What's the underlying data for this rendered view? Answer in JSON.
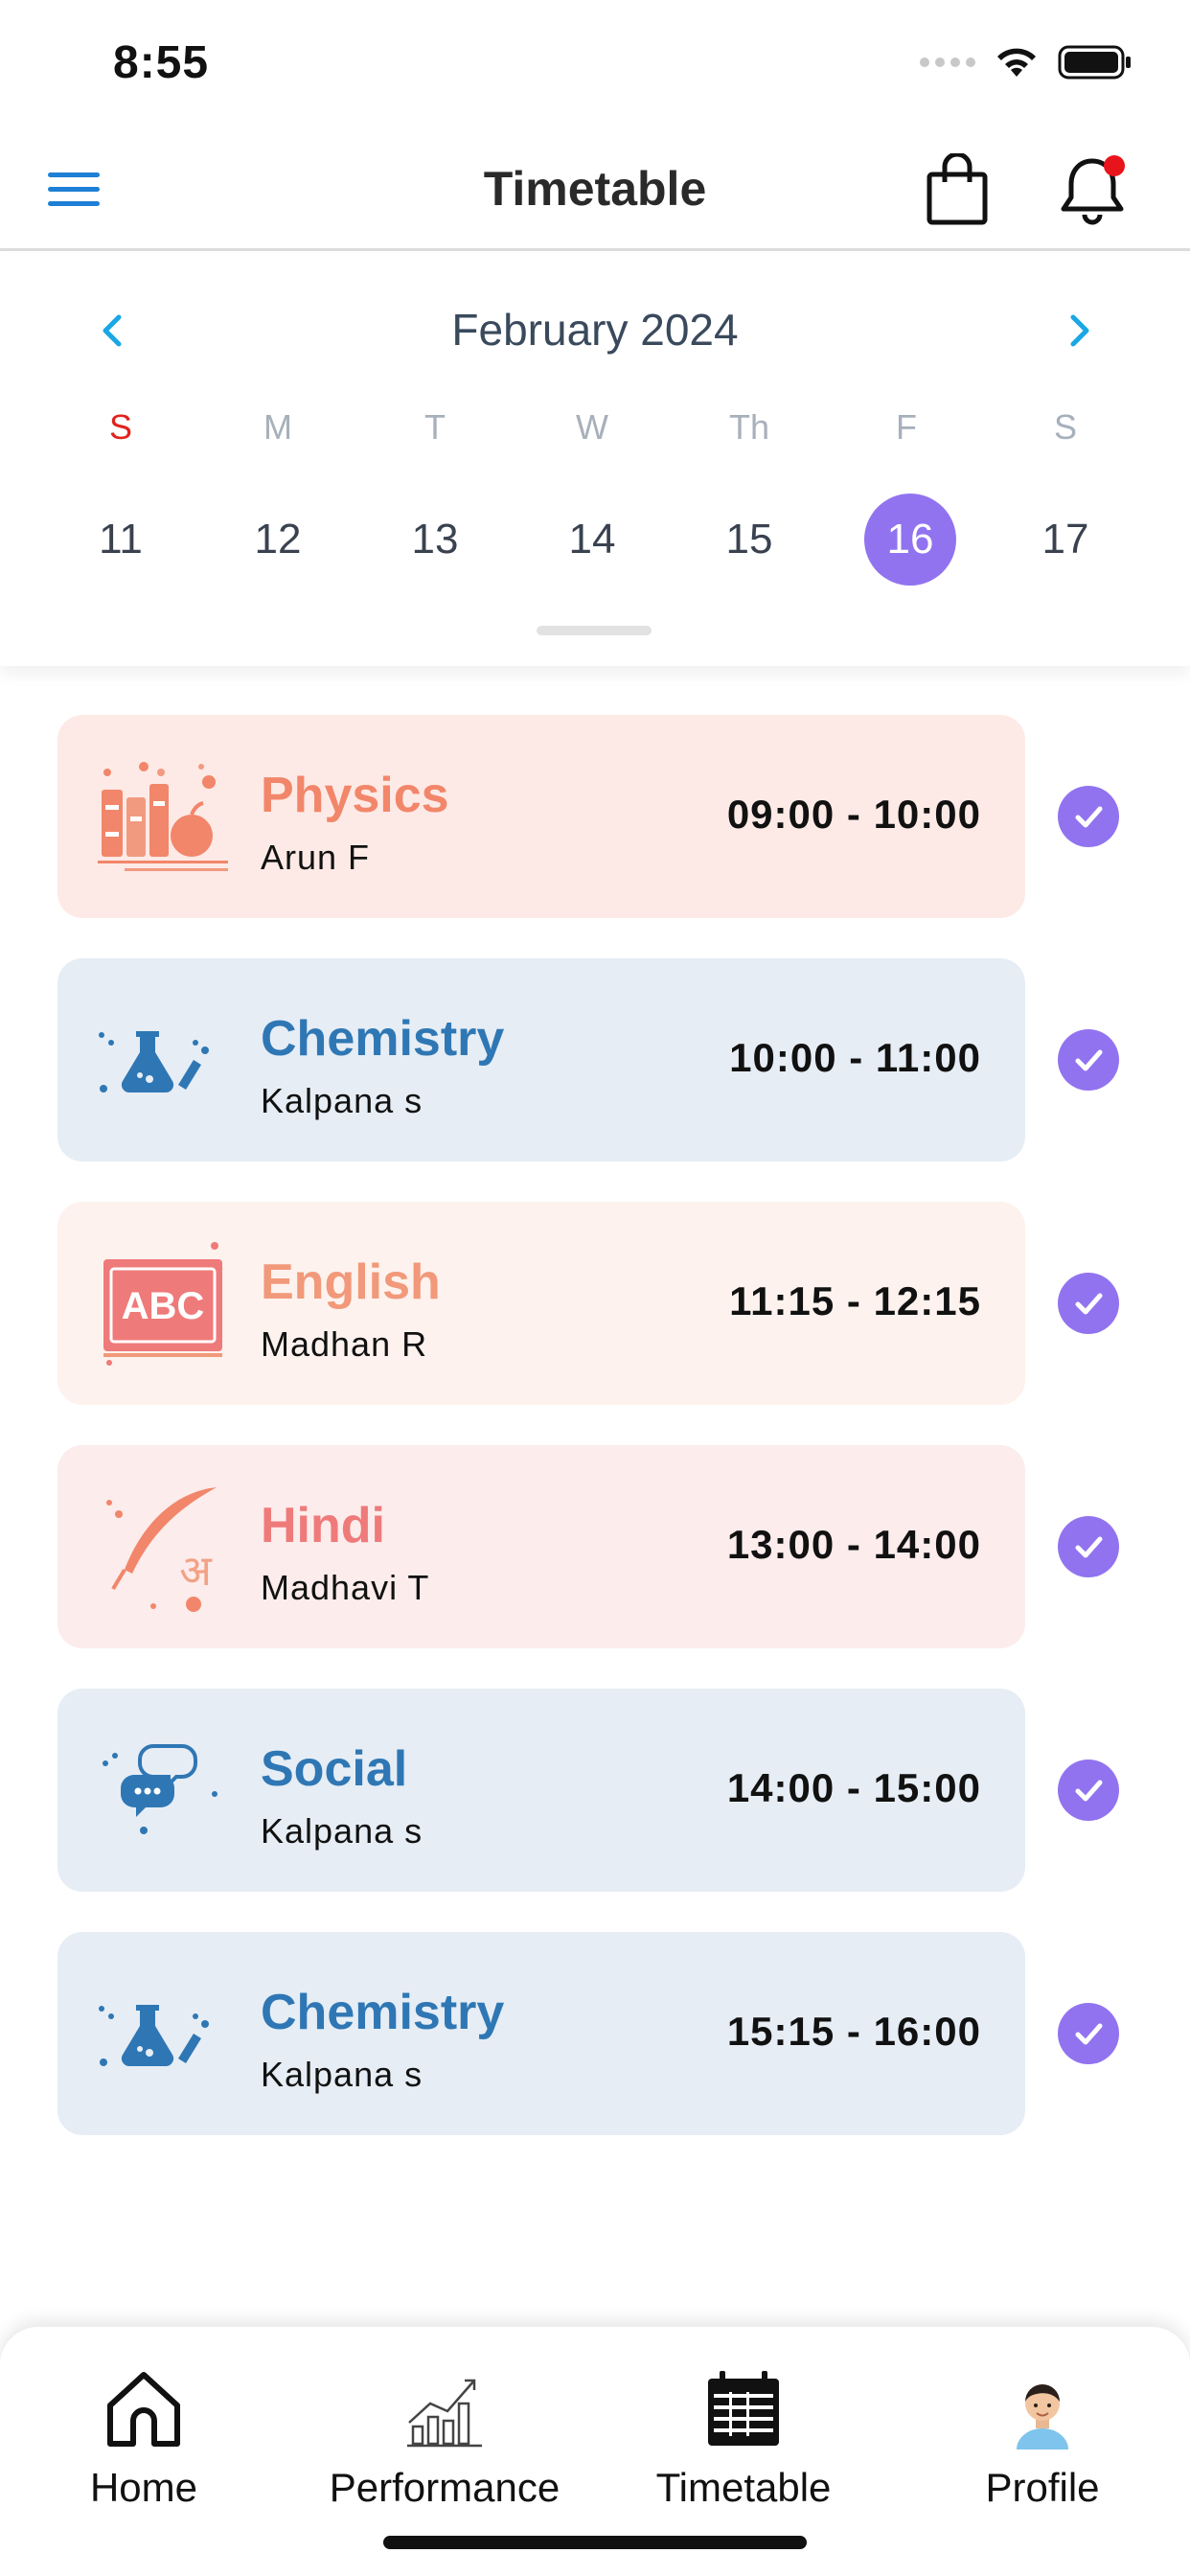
{
  "status_bar": {
    "time": "8:55"
  },
  "header": {
    "title": "Timetable"
  },
  "calendar": {
    "month_label": "February 2024",
    "weekdays": [
      "S",
      "M",
      "T",
      "W",
      "Th",
      "F",
      "S"
    ],
    "dates": [
      "11",
      "12",
      "13",
      "14",
      "15",
      "16",
      "17"
    ],
    "selected_date": "16"
  },
  "lessons": [
    {
      "subject": "Physics",
      "teacher": "Arun F",
      "time": "09:00 - 10:00",
      "icon": "books-apple-icon",
      "completed": true
    },
    {
      "subject": "Chemistry",
      "teacher": "Kalpana s",
      "time": "10:00 - 11:00",
      "icon": "flask-icon",
      "completed": true
    },
    {
      "subject": "English",
      "teacher": "Madhan R",
      "time": "11:15 - 12:15",
      "icon": "abc-board-icon",
      "completed": true
    },
    {
      "subject": "Hindi",
      "teacher": "Madhavi T",
      "time": "13:00 - 14:00",
      "icon": "quill-hindi-icon",
      "completed": true
    },
    {
      "subject": "Social",
      "teacher": "Kalpana s",
      "time": "14:00 - 15:00",
      "icon": "chat-bubbles-icon",
      "completed": true
    },
    {
      "subject": "Chemistry",
      "teacher": "Kalpana s",
      "time": "15:15 - 16:00",
      "icon": "flask-icon",
      "completed": true
    }
  ],
  "tabbar": {
    "items": [
      {
        "label": "Home",
        "icon": "home-icon"
      },
      {
        "label": "Performance",
        "icon": "chart-growth-icon"
      },
      {
        "label": "Timetable",
        "icon": "calendar-icon",
        "active": true
      },
      {
        "label": "Profile",
        "icon": "avatar-icon"
      }
    ]
  },
  "colors": {
    "accent": "#9173f0",
    "nav_arrow": "#1aa7e4",
    "sunday": "#e0231c",
    "physics_bg": "#fdeae6",
    "physics_text": "#f2866a",
    "chemistry_bg": "#e6edf5",
    "chemistry_text": "#2f77b4",
    "english_bg": "#fdf2ee",
    "english_text": "#f1997a",
    "hindi_bg": "#fcecec",
    "hindi_text": "#ef7a7a",
    "social_bg": "#e6edf5",
    "social_text": "#2f77b4"
  }
}
